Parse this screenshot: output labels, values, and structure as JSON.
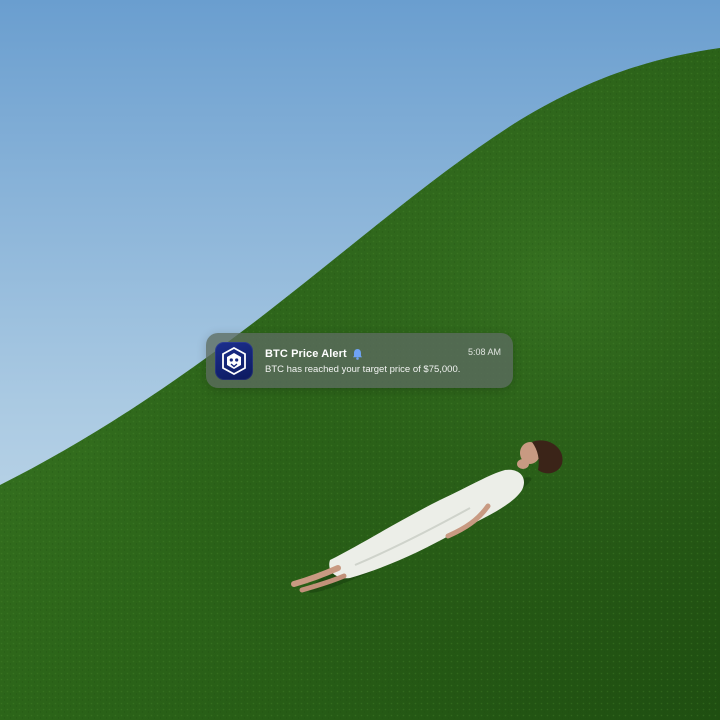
{
  "notification": {
    "app_icon": "crypto-com-lion-shield-icon",
    "title": "BTC Price Alert",
    "title_icon": "bell-icon",
    "time": "5:08 AM",
    "body": "BTC has reached your target price of $75,000."
  },
  "colors": {
    "sky_top": "#6b9fd0",
    "sky_bottom": "#c6dceb",
    "grass": "#2f6b1c",
    "app_icon_bg": "#13247a",
    "bell": "#6fa3f4"
  }
}
